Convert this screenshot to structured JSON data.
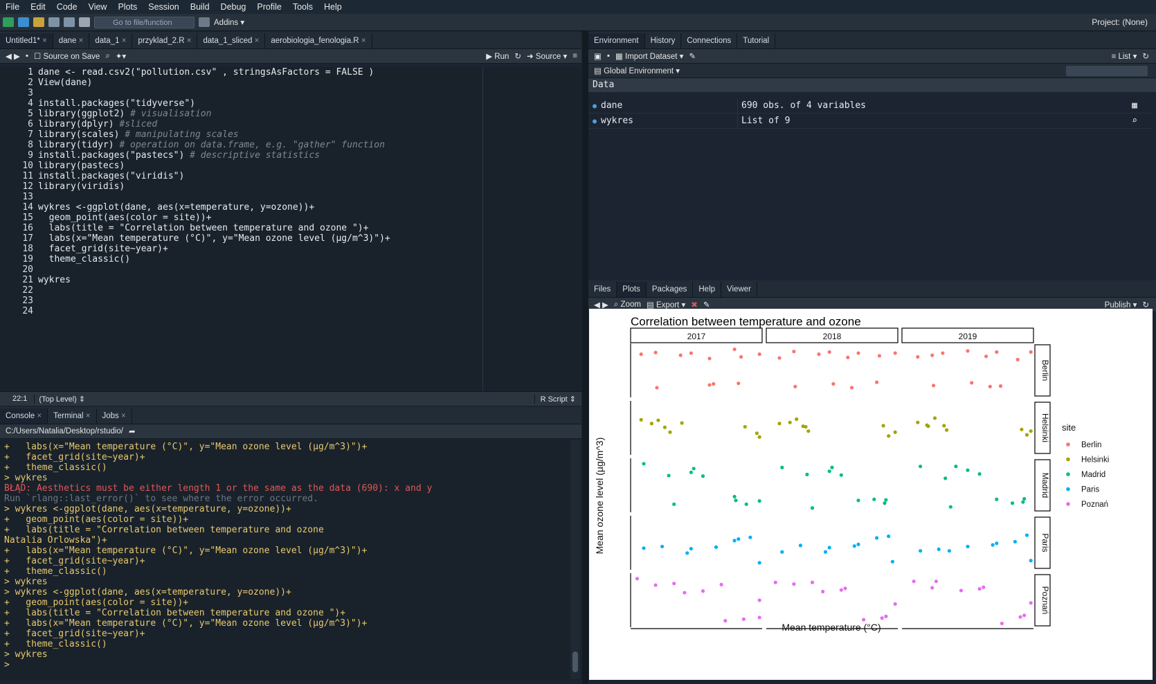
{
  "menu": [
    "File",
    "Edit",
    "Code",
    "View",
    "Plots",
    "Session",
    "Build",
    "Debug",
    "Profile",
    "Tools",
    "Help"
  ],
  "toolbar": {
    "goto_placeholder": "Go to file/function",
    "addins": "Addins",
    "project": "Project: (None)"
  },
  "editor": {
    "tabs": [
      "Untitled1*",
      "dane",
      "data_1",
      "przyklad_2.R",
      "data_1_sliced",
      "aerobiologia_fenologia.R"
    ],
    "source_on_save": "Source on Save",
    "run": "Run",
    "source": "Source",
    "lines": [
      "dane <- read.csv2(\"pollution.csv\" , stringsAsFactors = FALSE )",
      "View(dane)",
      "",
      "install.packages(\"tidyverse\")",
      "library(ggplot2) # visualisation",
      "library(dplyr) #sliced",
      "library(scales) # manipulating scales",
      "library(tidyr) # operation on data.frame, e.g. \"gather\" function",
      "install.packages(\"pastecs\") # descriptive statistics",
      "library(pastecs)",
      "install.packages(\"viridis\")",
      "library(viridis)",
      "",
      "wykres <-ggplot(dane, aes(x=temperature, y=ozone))+",
      "  geom_point(aes(color = site))+",
      "  labs(title = \"Correlation between temperature and ozone \")+",
      "  labs(x=\"Mean temperature (°C)\", y=\"Mean ozone level (µg/m^3)\")+",
      "  facet_grid(site~year)+",
      "  theme_classic()",
      "",
      "wykres",
      "",
      "",
      ""
    ],
    "status_pos": "22:1",
    "status_scope": "(Top Level)",
    "status_type": "R Script"
  },
  "console": {
    "tabs": [
      "Console",
      "Terminal",
      "Jobs"
    ],
    "path": "C:/Users/Natalia/Desktop/rstudio/",
    "lines": [
      {
        "t": "+   labs(x=\"Mean temperature (°C)\", y=\"Mean ozone level (µg/m^3)\")+",
        "c": "pr"
      },
      {
        "t": "+   facet_grid(site~year)+",
        "c": "pr"
      },
      {
        "t": "+   theme_classic()",
        "c": "pr"
      },
      {
        "t": "> wykres",
        "c": "pr"
      },
      {
        "t": "BŁĄD: Aesthetics must be either length 1 or the same as the data (690): x and y",
        "c": "err"
      },
      {
        "t": "Run `rlang::last_error()` to see where the error occurred.",
        "c": "dim"
      },
      {
        "t": "> wykres <-ggplot(dane, aes(x=temperature, y=ozone))+",
        "c": "pr"
      },
      {
        "t": "+   geom_point(aes(color = site))+",
        "c": "pr"
      },
      {
        "t": "+   labs(title = \"Correlation between temperature and ozone",
        "c": "pr"
      },
      {
        "t": "Natalia Orlowska\")+",
        "c": "pr"
      },
      {
        "t": "+   labs(x=\"Mean temperature (°C)\", y=\"Mean ozone level (µg/m^3)\")+",
        "c": "pr"
      },
      {
        "t": "+   facet_grid(site~year)+",
        "c": "pr"
      },
      {
        "t": "+   theme_classic()",
        "c": "pr"
      },
      {
        "t": "> wykres",
        "c": "pr"
      },
      {
        "t": "> wykres <-ggplot(dane, aes(x=temperature, y=ozone))+",
        "c": "pr"
      },
      {
        "t": "+   geom_point(aes(color = site))+",
        "c": "pr"
      },
      {
        "t": "+   labs(title = \"Correlation between temperature and ozone \")+",
        "c": "pr"
      },
      {
        "t": "+   labs(x=\"Mean temperature (°C)\", y=\"Mean ozone level (µg/m^3)\")+",
        "c": "pr"
      },
      {
        "t": "+   facet_grid(site~year)+",
        "c": "pr"
      },
      {
        "t": "+   theme_classic()",
        "c": "pr"
      },
      {
        "t": "> wykres",
        "c": "pr"
      },
      {
        "t": "> ",
        "c": "pr"
      }
    ]
  },
  "environment": {
    "tabs": [
      "Environment",
      "History",
      "Connections",
      "Tutorial"
    ],
    "import_dataset": "Import Dataset",
    "list_label": "List",
    "global_env": "Global Environment",
    "section": "Data",
    "rows": [
      {
        "name": "dane",
        "value": "690 obs. of 4 variables"
      },
      {
        "name": "wykres",
        "value": "List of 9"
      }
    ]
  },
  "files": {
    "tabs": [
      "Files",
      "Plots",
      "Packages",
      "Help",
      "Viewer"
    ],
    "zoom": "Zoom",
    "export": "Export",
    "publish": "Publish"
  },
  "chart_data": {
    "type": "scatter",
    "title": "Correlation between temperature and ozone",
    "xlabel": "Mean temperature (°C)",
    "ylabel": "Mean ozone level (µg/m^3)",
    "facet_cols": [
      "2017",
      "2018",
      "2019"
    ],
    "facet_rows": [
      "Berlin",
      "Helsinki",
      "Madrid",
      "Paris",
      "Poznań"
    ],
    "legend_title": "site",
    "legend_position": "right",
    "colors": {
      "Berlin": "#f8766d",
      "Helsinki": "#a3a500",
      "Madrid": "#00bf7d",
      "Paris": "#00b0f6",
      "Poznań": "#e76bf3"
    },
    "series": [
      {
        "name": "Berlin",
        "values": [
          [
            0.08,
            0.2
          ],
          [
            0.15,
            0.15
          ],
          [
            0.3,
            0.18
          ],
          [
            0.45,
            0.12
          ],
          [
            0.55,
            0.2
          ],
          [
            0.7,
            0.1
          ],
          [
            0.82,
            0.22
          ],
          [
            0.92,
            0.15
          ],
          [
            0.5,
            0.7
          ],
          [
            0.6,
            0.75
          ],
          [
            0.75,
            0.72
          ],
          [
            0.2,
            0.78
          ]
        ]
      },
      {
        "name": "Helsinki",
        "values": [
          [
            0.08,
            0.35
          ],
          [
            0.12,
            0.4
          ],
          [
            0.18,
            0.45
          ],
          [
            0.2,
            0.3
          ],
          [
            0.25,
            0.5
          ],
          [
            0.3,
            0.4
          ],
          [
            0.85,
            0.45
          ],
          [
            0.9,
            0.55
          ],
          [
            0.92,
            0.6
          ]
        ]
      },
      {
        "name": "Madrid",
        "values": [
          [
            0.1,
            0.1
          ],
          [
            0.25,
            0.3
          ],
          [
            0.4,
            0.15
          ],
          [
            0.45,
            0.2
          ],
          [
            0.5,
            0.25
          ],
          [
            0.7,
            0.7
          ],
          [
            0.78,
            0.75
          ],
          [
            0.82,
            0.8
          ],
          [
            0.9,
            0.72
          ],
          [
            0.3,
            0.85
          ]
        ]
      },
      {
        "name": "Paris",
        "values": [
          [
            0.1,
            0.6
          ],
          [
            0.2,
            0.55
          ],
          [
            0.35,
            0.65
          ],
          [
            0.45,
            0.55
          ],
          [
            0.6,
            0.5
          ],
          [
            0.7,
            0.45
          ],
          [
            0.8,
            0.4
          ],
          [
            0.85,
            0.35
          ],
          [
            0.95,
            0.8
          ]
        ]
      },
      {
        "name": "Poznań",
        "values": [
          [
            0.05,
            0.1
          ],
          [
            0.15,
            0.2
          ],
          [
            0.25,
            0.15
          ],
          [
            0.4,
            0.3
          ],
          [
            0.5,
            0.25
          ],
          [
            0.6,
            0.2
          ],
          [
            0.7,
            0.85
          ],
          [
            0.8,
            0.8
          ],
          [
            0.9,
            0.75
          ],
          [
            0.95,
            0.5
          ]
        ]
      }
    ]
  }
}
